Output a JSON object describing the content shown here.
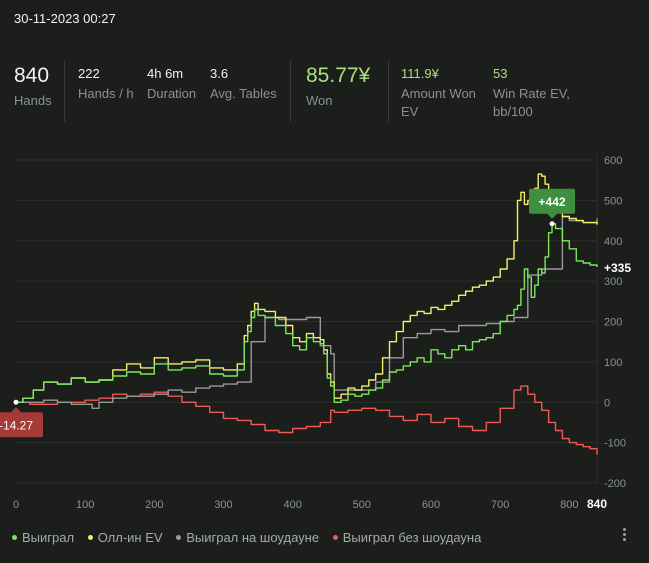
{
  "header": {
    "datetime": "30-11-2023 00:27"
  },
  "stats": {
    "hands": {
      "value": "840",
      "label": "Hands"
    },
    "hands_per_hour": {
      "value": "222",
      "label": "Hands / h"
    },
    "duration": {
      "value": "4h 6m",
      "label": "Duration"
    },
    "avg_tables": {
      "value": "3.6",
      "label": "Avg. Tables"
    },
    "won": {
      "value": "85.77¥",
      "label": "Won"
    },
    "amount_won_ev": {
      "value": "111.9¥",
      "label": "Amount Won EV"
    },
    "win_rate_ev": {
      "value": "53",
      "label": "Win Rate EV, bb/100"
    }
  },
  "colors": {
    "won": "#7be85c",
    "allin_ev": "#f3ee6a",
    "showdown": "#9a9a9a",
    "non_showdown": "#ef5a56"
  },
  "chart_data": {
    "type": "line",
    "x_ticks": [
      "0",
      "100",
      "200",
      "300",
      "400",
      "500",
      "600",
      "700",
      "800"
    ],
    "x_end_label": "840",
    "y_ticks": [
      "600",
      "500",
      "400",
      "300",
      "200",
      "100",
      "0",
      "-100",
      "-200"
    ],
    "xlim": [
      0,
      840
    ],
    "ylim": [
      -200,
      600
    ],
    "annotations": {
      "peak": "+442",
      "trough": "-14.27",
      "final": "+335"
    },
    "series": [
      {
        "name": "Выиграл",
        "color": "#7be85c",
        "x": [
          0,
          10,
          25,
          40,
          60,
          80,
          100,
          120,
          140,
          160,
          180,
          200,
          220,
          240,
          260,
          280,
          300,
          320,
          330,
          335,
          340,
          345,
          350,
          360,
          375,
          390,
          400,
          410,
          420,
          430,
          440,
          445,
          450,
          455,
          460,
          470,
          480,
          490,
          500,
          510,
          520,
          530,
          540,
          550,
          560,
          570,
          580,
          590,
          600,
          610,
          620,
          630,
          640,
          650,
          660,
          670,
          680,
          690,
          700,
          710,
          720,
          725,
          730,
          735,
          740,
          745,
          750,
          755,
          760,
          765,
          770,
          775,
          780,
          790,
          800,
          810,
          820,
          830,
          840
        ],
        "y": [
          0,
          10,
          30,
          50,
          45,
          60,
          50,
          55,
          65,
          75,
          70,
          95,
          80,
          85,
          90,
          70,
          65,
          80,
          150,
          175,
          210,
          230,
          215,
          210,
          190,
          170,
          140,
          130,
          160,
          150,
          145,
          120,
          60,
          40,
          0,
          5,
          20,
          15,
          20,
          30,
          35,
          55,
          75,
          80,
          90,
          100,
          110,
          100,
          130,
          120,
          110,
          130,
          140,
          130,
          150,
          155,
          160,
          170,
          200,
          215,
          230,
          240,
          280,
          330,
          310,
          260,
          290,
          330,
          320,
          360,
          420,
          442,
          430,
          400,
          380,
          350,
          345,
          340,
          335
        ]
      },
      {
        "name": "Олл-ин EV",
        "color": "#f3ee6a",
        "x": [
          0,
          10,
          25,
          40,
          60,
          80,
          100,
          120,
          140,
          160,
          180,
          200,
          220,
          240,
          260,
          280,
          300,
          320,
          330,
          335,
          340,
          345,
          350,
          360,
          375,
          390,
          400,
          410,
          420,
          430,
          440,
          445,
          450,
          455,
          460,
          470,
          480,
          490,
          500,
          510,
          520,
          530,
          540,
          550,
          560,
          570,
          580,
          590,
          600,
          610,
          620,
          630,
          640,
          650,
          660,
          670,
          680,
          690,
          700,
          710,
          720,
          725,
          730,
          735,
          740,
          745,
          750,
          755,
          760,
          765,
          770,
          775,
          780,
          790,
          800,
          810,
          820,
          830,
          840
        ],
        "y": [
          0,
          10,
          30,
          50,
          45,
          60,
          50,
          55,
          80,
          95,
          85,
          110,
          95,
          100,
          105,
          85,
          80,
          95,
          165,
          190,
          225,
          245,
          230,
          225,
          210,
          190,
          160,
          150,
          170,
          160,
          155,
          130,
          70,
          50,
          10,
          20,
          35,
          30,
          40,
          55,
          70,
          110,
          150,
          175,
          200,
          215,
          225,
          220,
          235,
          230,
          240,
          250,
          265,
          275,
          285,
          290,
          300,
          310,
          330,
          355,
          400,
          500,
          520,
          490,
          500,
          510,
          530,
          565,
          560,
          540,
          505,
          480,
          470,
          460,
          455,
          450,
          445,
          445,
          440
        ]
      },
      {
        "name": "Выиграл на шоудауне",
        "color": "#9a9a9a",
        "x": [
          0,
          20,
          40,
          60,
          80,
          100,
          110,
          120,
          140,
          160,
          180,
          200,
          220,
          240,
          260,
          280,
          300,
          320,
          340,
          360,
          380,
          400,
          420,
          440,
          455,
          460,
          480,
          500,
          520,
          540,
          560,
          580,
          600,
          620,
          640,
          660,
          680,
          700,
          720,
          740,
          760,
          770,
          780,
          790,
          800,
          820,
          840
        ],
        "y": [
          0,
          0,
          5,
          0,
          -5,
          -5,
          -15,
          0,
          10,
          15,
          15,
          20,
          30,
          25,
          35,
          40,
          45,
          50,
          150,
          210,
          205,
          205,
          210,
          140,
          120,
          30,
          30,
          30,
          50,
          110,
          160,
          170,
          180,
          175,
          190,
          190,
          195,
          200,
          210,
          315,
          330,
          330,
          330,
          460,
          450,
          445,
          455
        ]
      },
      {
        "name": "Выиграл без шоудауна",
        "color": "#ef5a56",
        "x": [
          0,
          20,
          40,
          60,
          80,
          100,
          120,
          140,
          160,
          180,
          200,
          220,
          240,
          260,
          280,
          300,
          320,
          340,
          360,
          380,
          400,
          420,
          440,
          455,
          460,
          480,
          500,
          520,
          540,
          560,
          580,
          600,
          620,
          640,
          660,
          680,
          700,
          720,
          730,
          740,
          750,
          760,
          770,
          780,
          790,
          800,
          810,
          820,
          830,
          840
        ],
        "y": [
          0,
          -5,
          -5,
          0,
          0,
          5,
          10,
          20,
          15,
          20,
          25,
          15,
          0,
          -10,
          -25,
          -40,
          -45,
          -55,
          -70,
          -75,
          -65,
          -60,
          -50,
          -20,
          -25,
          -20,
          -15,
          -20,
          -35,
          -45,
          -30,
          -50,
          -40,
          -60,
          -70,
          -50,
          -15,
          30,
          40,
          20,
          0,
          -20,
          -50,
          -70,
          -90,
          -100,
          -105,
          -110,
          -115,
          -130
        ]
      }
    ]
  },
  "legend": {
    "won": "Выиграл",
    "allin_ev": "Олл-ин EV",
    "showdown": "Выиграл на шоудауне",
    "non_showdown": "Выиграл без шоудауна"
  }
}
